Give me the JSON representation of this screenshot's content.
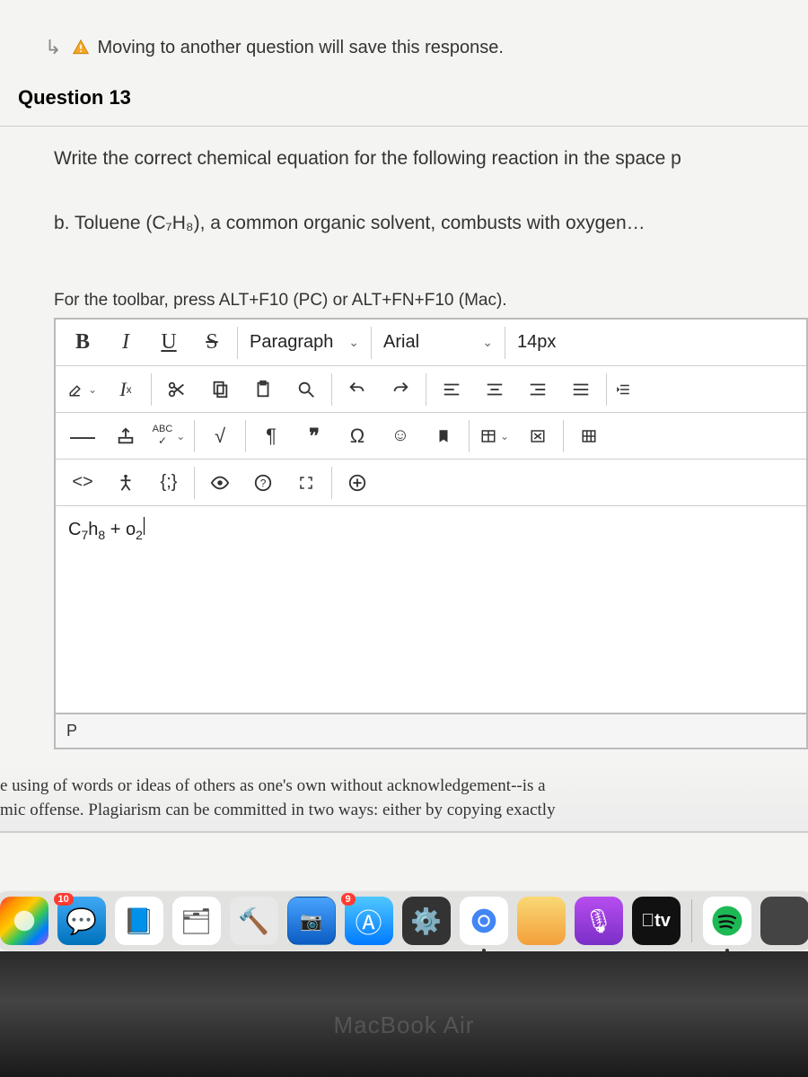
{
  "notice": {
    "text": "Moving to another question will save this response."
  },
  "question": {
    "header": "Question 13",
    "prompt": "Write the correct chemical equation for the following reaction in the space p",
    "line_b": "b. Toluene (C₇H₈), a common organic solvent, combusts with oxygen…",
    "toolbar_hint": "For the toolbar, press ALT+F10 (PC) or ALT+FN+F10 (Mac)."
  },
  "toolbar": {
    "row1": {
      "bold": "B",
      "italic": "I",
      "underline": "U",
      "strike": "S",
      "block_format": "Paragraph",
      "font_family": "Arial",
      "font_size": "14px"
    },
    "row2": {
      "clear_format": "Ix",
      "abc": "ABC"
    },
    "row4": {
      "codesample": "{;}"
    }
  },
  "editor": {
    "content_html": "C₇h₈ + o₂"
  },
  "status": {
    "path": "P"
  },
  "plagiarism": {
    "line1": "e using of words or ideas of others as one's own without acknowledgement--is a",
    "line2": "mic offense. Plagiarism can be committed in two ways: either by copying exactly"
  },
  "dock": {
    "apple_tv_label": "tv",
    "badge_10": "10",
    "badge_9": "9"
  },
  "hardware": {
    "label": "MacBook Air"
  }
}
